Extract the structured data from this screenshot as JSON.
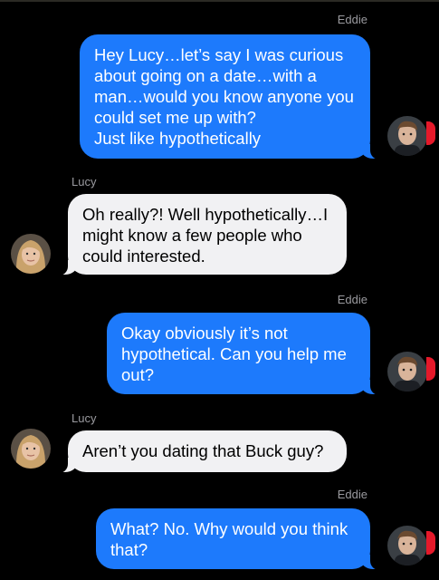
{
  "conversation": {
    "messages": [
      {
        "sender": "Eddie",
        "direction": "outgoing",
        "text": "Hey Lucy…let’s say I was curious about going on a date…with a man…would you know anyone you could set me up with?\nJust like hypothetically",
        "avatar_icon": "eddie-avatar-icon"
      },
      {
        "sender": "Lucy",
        "direction": "incoming",
        "text": "Oh really?! Well hypothetically…I might know a few people who could interested.",
        "avatar_icon": "lucy-avatar-icon"
      },
      {
        "sender": "Eddie",
        "direction": "outgoing",
        "text": "Okay obviously it’s not hypothetical. Can you help me out?",
        "avatar_icon": "eddie-avatar-icon"
      },
      {
        "sender": "Lucy",
        "direction": "incoming",
        "text": "Aren’t you dating that Buck guy?",
        "avatar_icon": "lucy-avatar-icon"
      },
      {
        "sender": "Eddie",
        "direction": "outgoing",
        "text": "What? No. Why would you think that?",
        "avatar_icon": "eddie-avatar-icon"
      }
    ]
  },
  "colors": {
    "background": "#000000",
    "outgoing_bubble": "#1d7afc",
    "incoming_bubble": "#f1f1f3",
    "sender_label": "#9a9a9f",
    "badge": "#e5192a"
  }
}
